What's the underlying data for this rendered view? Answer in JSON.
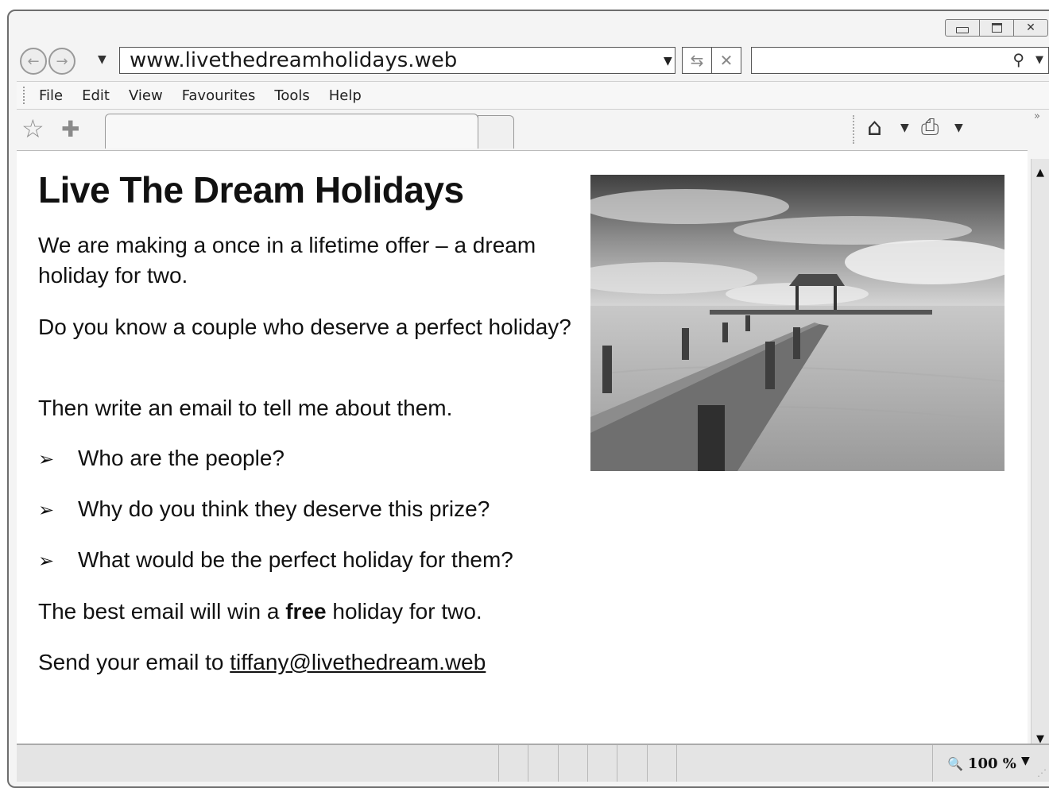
{
  "browser": {
    "address": "www.livethedreamholidays.web",
    "search_placeholder": "",
    "menu": [
      "File",
      "Edit",
      "View",
      "Favourites",
      "Tools",
      "Help"
    ],
    "zoom": "100 %"
  },
  "page": {
    "title": "Live The Dream Holidays",
    "paragraphs": [
      "We are making a once in a lifetime offer – a dream holiday for two.",
      "Do you know a couple who deserve a perfect holiday?",
      "Then write an email to tell me about them."
    ],
    "bullets": [
      "Who are the people?",
      "Why do you think they deserve this prize?",
      "What would be the perfect holiday for them?"
    ],
    "prize_before": "The best email will win a ",
    "prize_bold": "free",
    "prize_after": " holiday for two.",
    "send_before": "Send your email to ",
    "send_email": "tiffany@livethedream.web"
  },
  "icons": {
    "back": "back-arrow-icon",
    "forward": "forward-arrow-icon",
    "refresh": "refresh-icon",
    "stop": "stop-icon",
    "search": "search-icon",
    "favourite": "star-icon",
    "add_favourite": "add-favourite-icon",
    "home": "home-icon",
    "print": "printer-icon"
  }
}
